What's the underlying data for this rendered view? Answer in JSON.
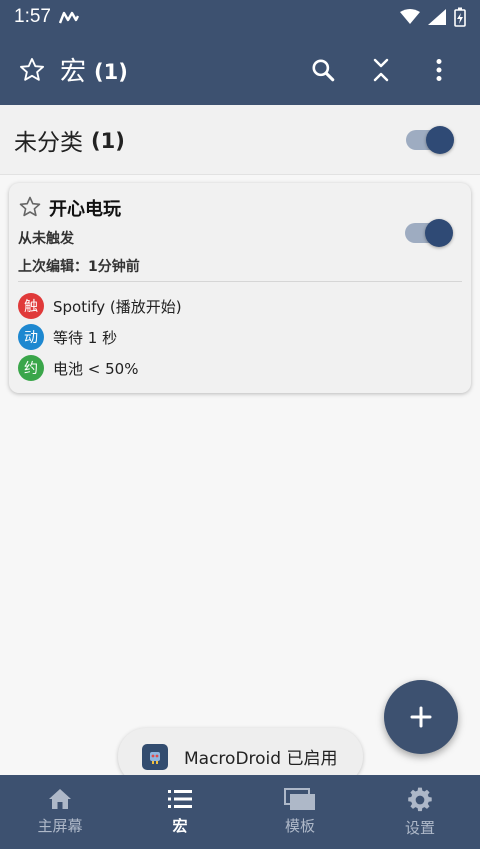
{
  "status_bar": {
    "time": "1:57"
  },
  "app_bar": {
    "title": "宏",
    "count": "(1)"
  },
  "category": {
    "name": "未分类",
    "count": "(1)",
    "enabled": true
  },
  "macro": {
    "name": "开心电玩",
    "trigger_status": "从未触发",
    "last_edit": "上次编辑：1分钟前",
    "enabled": true,
    "steps": [
      {
        "badge": "触",
        "color": "#e03a3a",
        "text": "Spotify (播放开始)"
      },
      {
        "badge": "动",
        "color": "#1e88d0",
        "text": "等待 1 秒"
      },
      {
        "badge": "约",
        "color": "#3aa64a",
        "text": "电池 < 50%"
      }
    ]
  },
  "toast": {
    "text": "MacroDroid 已启用"
  },
  "bottom_nav": [
    {
      "label": "主屏幕",
      "icon": "home-icon",
      "active": false
    },
    {
      "label": "宏",
      "icon": "list-icon",
      "active": true
    },
    {
      "label": "模板",
      "icon": "templates-icon",
      "active": false
    },
    {
      "label": "设置",
      "icon": "gear-icon",
      "active": false
    }
  ],
  "colors": {
    "primary": "#3d5170",
    "switch_knob": "#2f4a75"
  }
}
